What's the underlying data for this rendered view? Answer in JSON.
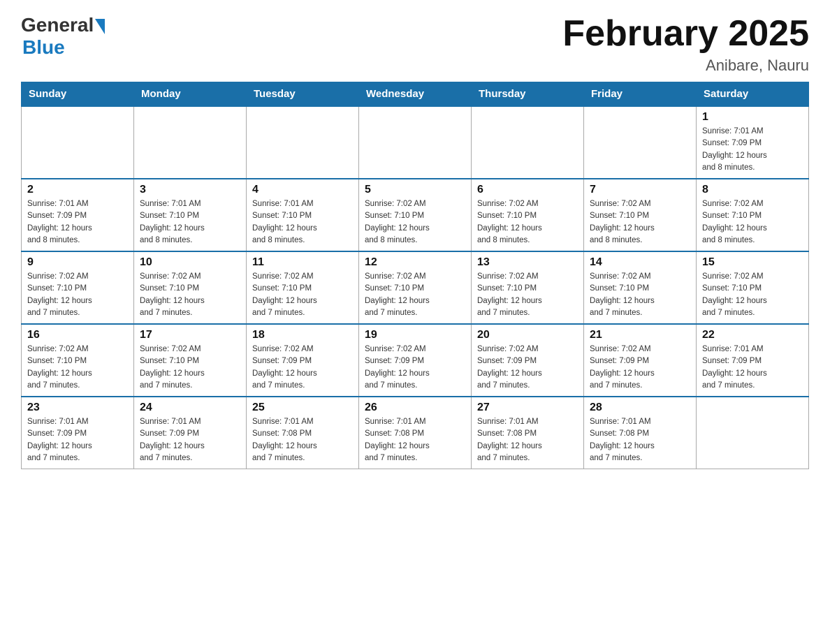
{
  "header": {
    "logo_general": "General",
    "logo_blue": "Blue",
    "month_title": "February 2025",
    "location": "Anibare, Nauru"
  },
  "weekdays": [
    "Sunday",
    "Monday",
    "Tuesday",
    "Wednesday",
    "Thursday",
    "Friday",
    "Saturday"
  ],
  "weeks": [
    [
      {
        "day": "",
        "info": ""
      },
      {
        "day": "",
        "info": ""
      },
      {
        "day": "",
        "info": ""
      },
      {
        "day": "",
        "info": ""
      },
      {
        "day": "",
        "info": ""
      },
      {
        "day": "",
        "info": ""
      },
      {
        "day": "1",
        "info": "Sunrise: 7:01 AM\nSunset: 7:09 PM\nDaylight: 12 hours\nand 8 minutes."
      }
    ],
    [
      {
        "day": "2",
        "info": "Sunrise: 7:01 AM\nSunset: 7:09 PM\nDaylight: 12 hours\nand 8 minutes."
      },
      {
        "day": "3",
        "info": "Sunrise: 7:01 AM\nSunset: 7:10 PM\nDaylight: 12 hours\nand 8 minutes."
      },
      {
        "day": "4",
        "info": "Sunrise: 7:01 AM\nSunset: 7:10 PM\nDaylight: 12 hours\nand 8 minutes."
      },
      {
        "day": "5",
        "info": "Sunrise: 7:02 AM\nSunset: 7:10 PM\nDaylight: 12 hours\nand 8 minutes."
      },
      {
        "day": "6",
        "info": "Sunrise: 7:02 AM\nSunset: 7:10 PM\nDaylight: 12 hours\nand 8 minutes."
      },
      {
        "day": "7",
        "info": "Sunrise: 7:02 AM\nSunset: 7:10 PM\nDaylight: 12 hours\nand 8 minutes."
      },
      {
        "day": "8",
        "info": "Sunrise: 7:02 AM\nSunset: 7:10 PM\nDaylight: 12 hours\nand 8 minutes."
      }
    ],
    [
      {
        "day": "9",
        "info": "Sunrise: 7:02 AM\nSunset: 7:10 PM\nDaylight: 12 hours\nand 7 minutes."
      },
      {
        "day": "10",
        "info": "Sunrise: 7:02 AM\nSunset: 7:10 PM\nDaylight: 12 hours\nand 7 minutes."
      },
      {
        "day": "11",
        "info": "Sunrise: 7:02 AM\nSunset: 7:10 PM\nDaylight: 12 hours\nand 7 minutes."
      },
      {
        "day": "12",
        "info": "Sunrise: 7:02 AM\nSunset: 7:10 PM\nDaylight: 12 hours\nand 7 minutes."
      },
      {
        "day": "13",
        "info": "Sunrise: 7:02 AM\nSunset: 7:10 PM\nDaylight: 12 hours\nand 7 minutes."
      },
      {
        "day": "14",
        "info": "Sunrise: 7:02 AM\nSunset: 7:10 PM\nDaylight: 12 hours\nand 7 minutes."
      },
      {
        "day": "15",
        "info": "Sunrise: 7:02 AM\nSunset: 7:10 PM\nDaylight: 12 hours\nand 7 minutes."
      }
    ],
    [
      {
        "day": "16",
        "info": "Sunrise: 7:02 AM\nSunset: 7:10 PM\nDaylight: 12 hours\nand 7 minutes."
      },
      {
        "day": "17",
        "info": "Sunrise: 7:02 AM\nSunset: 7:10 PM\nDaylight: 12 hours\nand 7 minutes."
      },
      {
        "day": "18",
        "info": "Sunrise: 7:02 AM\nSunset: 7:09 PM\nDaylight: 12 hours\nand 7 minutes."
      },
      {
        "day": "19",
        "info": "Sunrise: 7:02 AM\nSunset: 7:09 PM\nDaylight: 12 hours\nand 7 minutes."
      },
      {
        "day": "20",
        "info": "Sunrise: 7:02 AM\nSunset: 7:09 PM\nDaylight: 12 hours\nand 7 minutes."
      },
      {
        "day": "21",
        "info": "Sunrise: 7:02 AM\nSunset: 7:09 PM\nDaylight: 12 hours\nand 7 minutes."
      },
      {
        "day": "22",
        "info": "Sunrise: 7:01 AM\nSunset: 7:09 PM\nDaylight: 12 hours\nand 7 minutes."
      }
    ],
    [
      {
        "day": "23",
        "info": "Sunrise: 7:01 AM\nSunset: 7:09 PM\nDaylight: 12 hours\nand 7 minutes."
      },
      {
        "day": "24",
        "info": "Sunrise: 7:01 AM\nSunset: 7:09 PM\nDaylight: 12 hours\nand 7 minutes."
      },
      {
        "day": "25",
        "info": "Sunrise: 7:01 AM\nSunset: 7:08 PM\nDaylight: 12 hours\nand 7 minutes."
      },
      {
        "day": "26",
        "info": "Sunrise: 7:01 AM\nSunset: 7:08 PM\nDaylight: 12 hours\nand 7 minutes."
      },
      {
        "day": "27",
        "info": "Sunrise: 7:01 AM\nSunset: 7:08 PM\nDaylight: 12 hours\nand 7 minutes."
      },
      {
        "day": "28",
        "info": "Sunrise: 7:01 AM\nSunset: 7:08 PM\nDaylight: 12 hours\nand 7 minutes."
      },
      {
        "day": "",
        "info": ""
      }
    ]
  ]
}
